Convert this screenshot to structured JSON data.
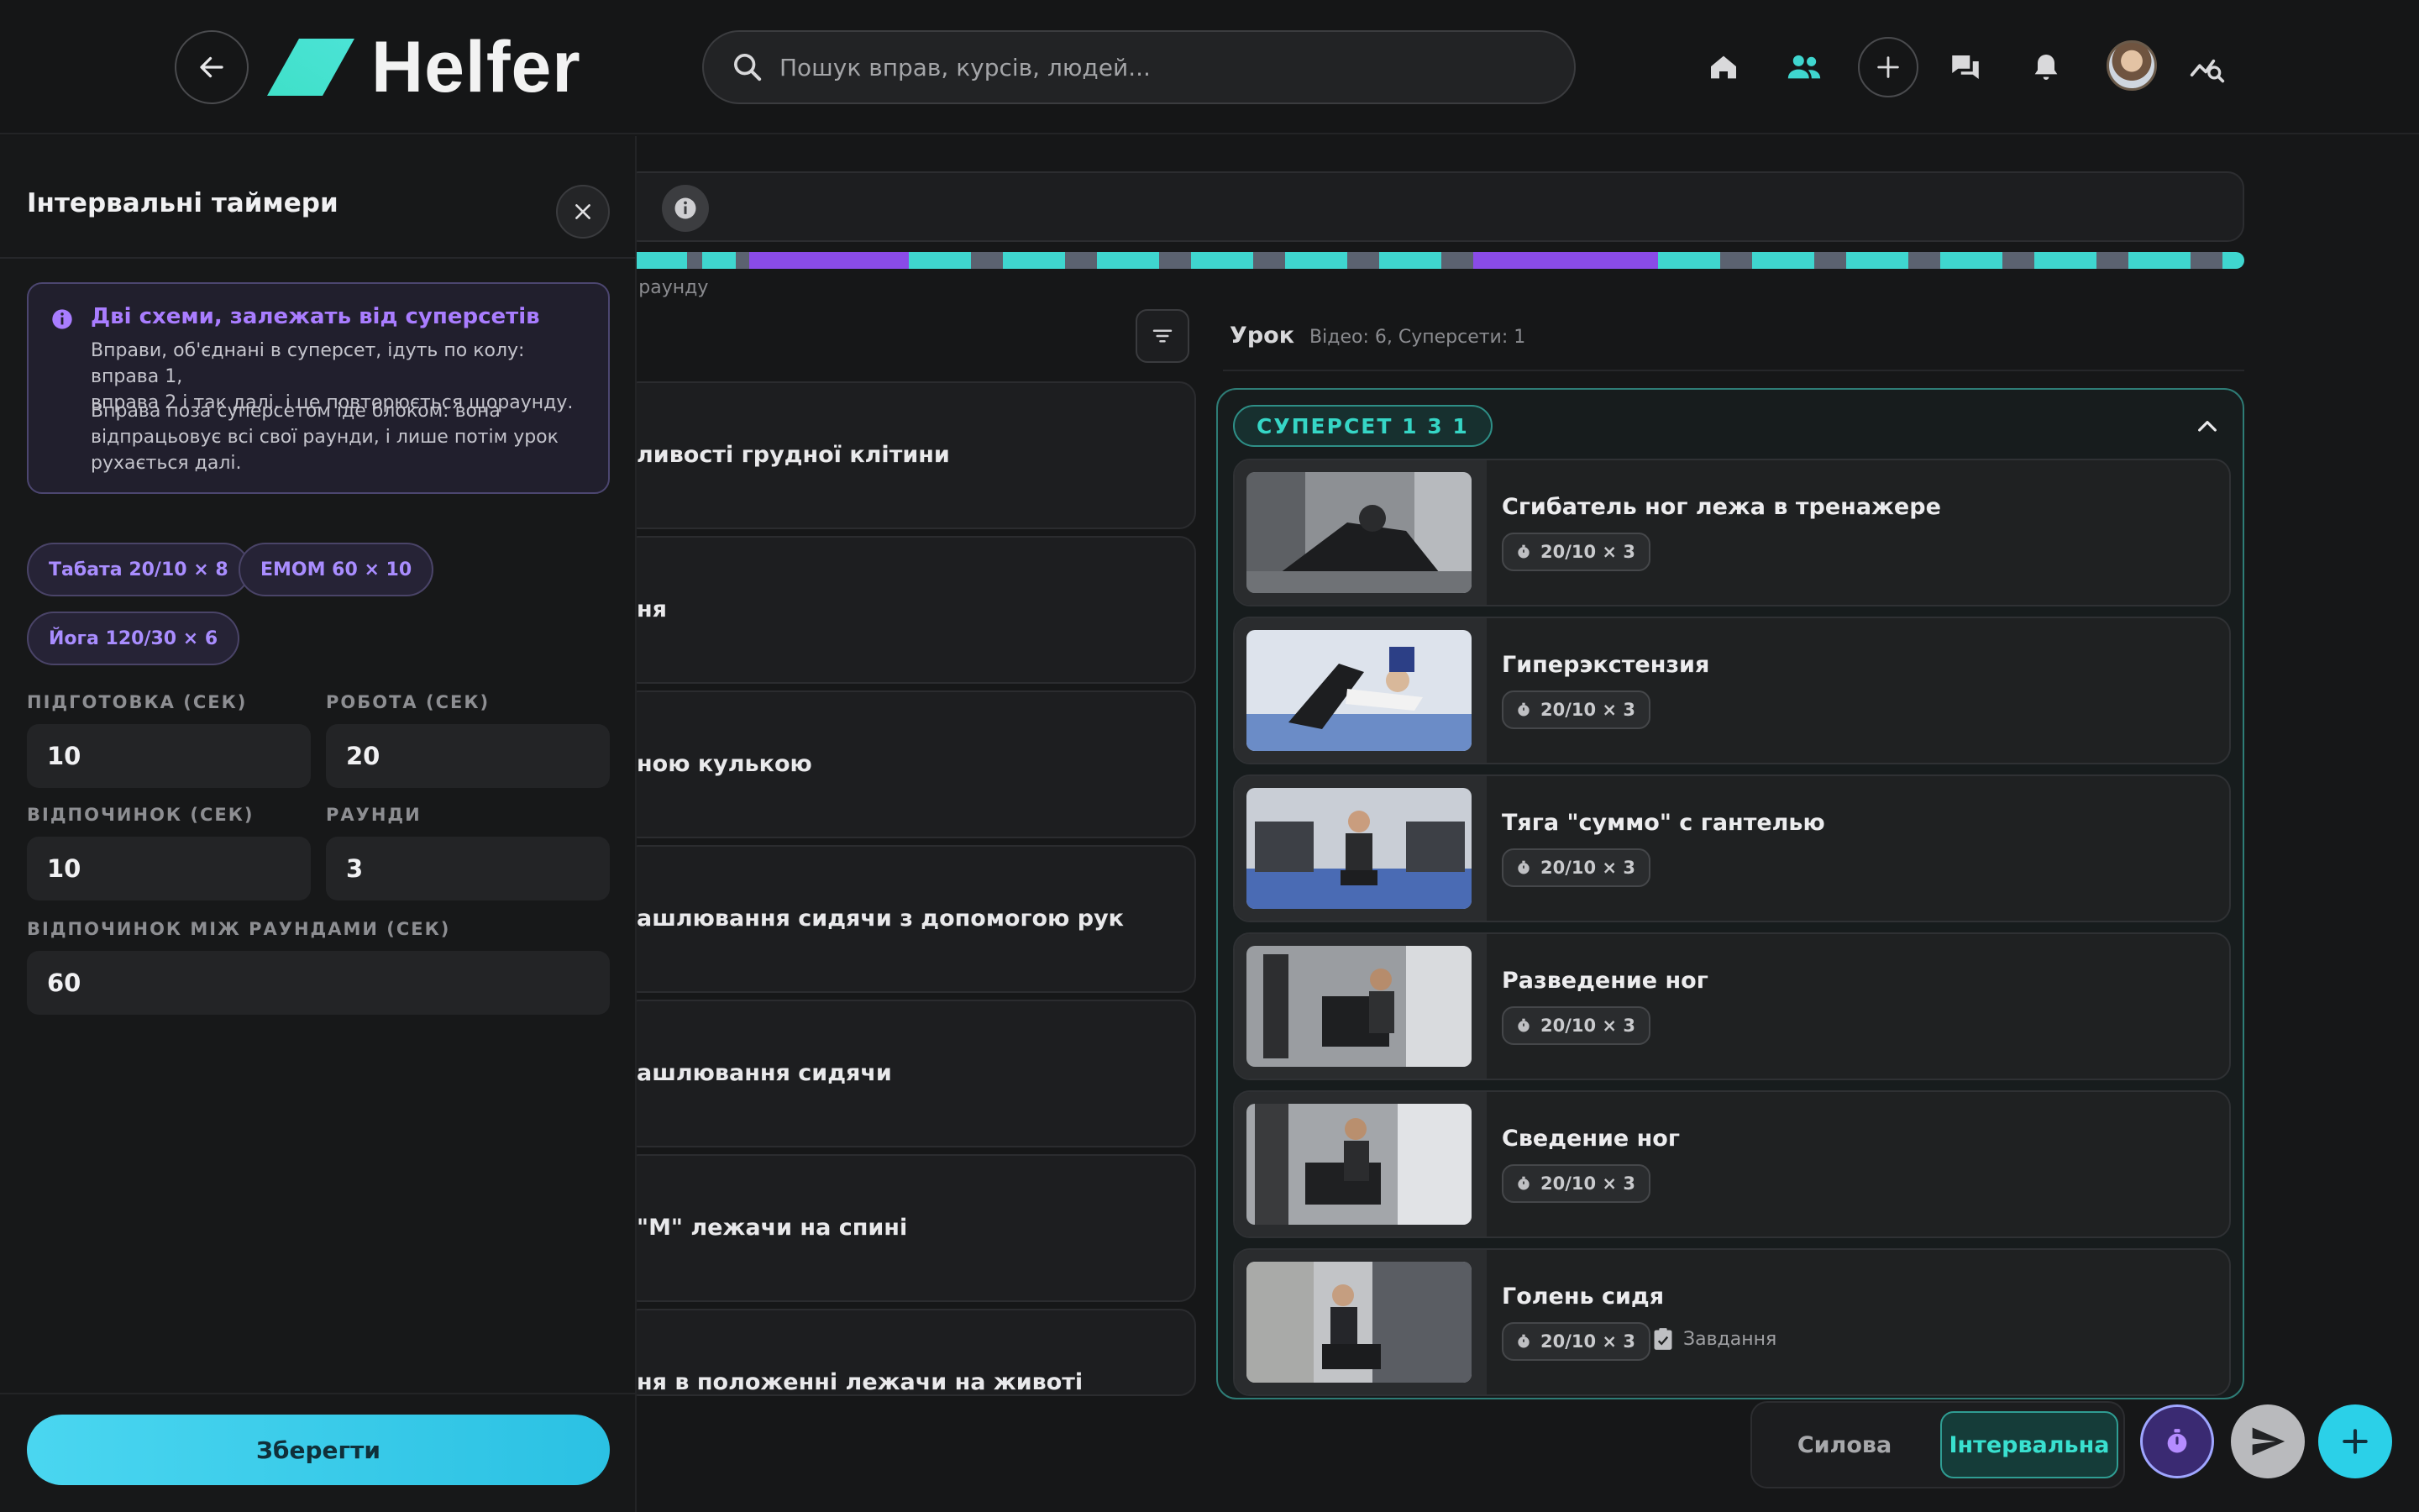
{
  "header": {
    "logo_text": "Helfer",
    "search_placeholder": "Пошук вправ, курсів, людей...",
    "nav_icons": [
      "home-icon",
      "people-icon",
      "plus-icon",
      "chat-icon",
      "bell-icon",
      "avatar",
      "analytics-icon"
    ]
  },
  "timeline": {
    "caption": "к раунду"
  },
  "lesson": {
    "title": "Урок",
    "meta": "Відео: 6, Суперсети: 1"
  },
  "library": {
    "items": [
      {
        "label": "ливості грудної клітини"
      },
      {
        "label": "ня"
      },
      {
        "label": "ною кулькою"
      },
      {
        "label": "ашлювання сидячи з допомогою рук"
      },
      {
        "label": "ашлювання сидячи"
      },
      {
        "label": "\"M\" лежачи на спині"
      },
      {
        "label": "ня в положенні лежачи на животі"
      }
    ]
  },
  "superset": {
    "badge": "СУПЕРСЕТ 1 3 1",
    "exercises": [
      {
        "title": "Сгибатель ног лежа в тренажере",
        "chip": "20/10 × 3"
      },
      {
        "title": "Гиперэкстензия",
        "chip": "20/10 × 3"
      },
      {
        "title": "Тяга \"суммо\" с гантелью",
        "chip": "20/10 × 3"
      },
      {
        "title": "Разведение ног",
        "chip": "20/10 × 3"
      },
      {
        "title": "Сведение ног",
        "chip": "20/10 × 3"
      },
      {
        "title": "Голень сидя",
        "chip": "20/10 × 3",
        "task": "Завдання"
      }
    ]
  },
  "mode": {
    "strength": "Силова",
    "interval": "Інтервальна"
  },
  "drawer": {
    "title": "Інтервальні таймери",
    "notice": {
      "title": "Дві схеми, залежать від суперсетів",
      "p1_line1": "Вправи, об'єднані в суперсет, ідуть по колу: вправа 1,",
      "p1_line2": "вправа 2 і так далі, і це повторюється щораунду.",
      "p2_line1": "Вправа поза суперсетом іде блоком: вона",
      "p2_line2": "відпрацьовує всі свої раунди, і лише потім урок",
      "p2_line3": "рухається далі."
    },
    "presets": [
      "Табата 20/10 × 8",
      "EMOM 60 × 10",
      "Йога 120/30 × 6"
    ],
    "fields": {
      "prep_label": "ПІДГОТОВКА (СЕК)",
      "prep_value": "10",
      "work_label": "РОБОТА (СЕК)",
      "work_value": "20",
      "rest_label": "ВІДПОЧИНОК (СЕК)",
      "rest_value": "10",
      "rounds_label": "РАУНДИ",
      "rounds_value": "3",
      "round_rest_label": "ВІДПОЧИНОК МІЖ РАУНДАМИ (СЕК)",
      "round_rest_value": "60"
    },
    "save_label": "Зберегти"
  },
  "colors": {
    "accent_teal": "#36d6c6",
    "accent_purple": "#a97dff",
    "timeline_work": "#3fd6cf",
    "timeline_rest": "#5b6270",
    "timeline_prep": "#8a4be8"
  }
}
